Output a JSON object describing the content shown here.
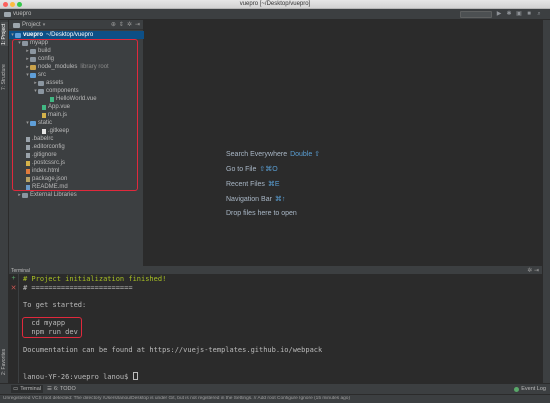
{
  "window": {
    "title": "vuepro [~/Desktop/vuepro]"
  },
  "toolbar": {
    "breadcrumb": "vuepro"
  },
  "left_strip": {
    "project_tab": "1: Project",
    "structure_tab": "7: Structure",
    "favorites_tab": "2: Favorites"
  },
  "project_panel": {
    "title": "Project",
    "root_label": "vuepro",
    "root_path": "~/Desktop/vuepro",
    "items": [
      {
        "label": "myapp",
        "kind": "folder",
        "arrow": "▾"
      },
      {
        "label": "build",
        "kind": "folder",
        "arrow": "▸"
      },
      {
        "label": "config",
        "kind": "folder",
        "arrow": "▸"
      },
      {
        "label": "node_modules",
        "kind": "folder",
        "arrow": "▸",
        "note": "library root"
      },
      {
        "label": "src",
        "kind": "folder",
        "arrow": "▾"
      },
      {
        "label": "assets",
        "kind": "folder",
        "arrow": "▸"
      },
      {
        "label": "components",
        "kind": "folder",
        "arrow": "▾"
      },
      {
        "label": "HelloWorld.vue",
        "kind": "vue"
      },
      {
        "label": "App.vue",
        "kind": "vue"
      },
      {
        "label": "main.js",
        "kind": "js"
      },
      {
        "label": "static",
        "kind": "folder",
        "arrow": "▾"
      },
      {
        "label": ".gitkeep",
        "kind": "file"
      },
      {
        "label": ".babelrc",
        "kind": "file"
      },
      {
        "label": ".editorconfig",
        "kind": "file"
      },
      {
        "label": ".gitignore",
        "kind": "file"
      },
      {
        "label": ".postcssrc.js",
        "kind": "js"
      },
      {
        "label": "index.html",
        "kind": "html"
      },
      {
        "label": "package.json",
        "kind": "json"
      },
      {
        "label": "README.md",
        "kind": "md"
      },
      {
        "label": "External Libraries",
        "kind": "lib"
      }
    ]
  },
  "editor_hints": [
    {
      "label": "Search Everywhere",
      "key": "Double ⇧"
    },
    {
      "label": "Go to File",
      "key": "⇧⌘O"
    },
    {
      "label": "Recent Files",
      "key": "⌘E"
    },
    {
      "label": "Navigation Bar",
      "key": "⌘↑"
    },
    {
      "label": "Drop files here to open",
      "key": ""
    }
  ],
  "terminal": {
    "title": "Terminal",
    "lines": [
      "# Project initialization finished!",
      "# ========================",
      "",
      "To get started:",
      "",
      "  cd myapp",
      "  npm run dev",
      "",
      "Documentation can be found at https://vuejs-templates.github.io/webpack",
      "",
      "",
      "lanou-YF-26:vuepro lanou$ "
    ]
  },
  "bottom_tabs": {
    "terminal": "Terminal",
    "todo": "6: TODO",
    "event_log": "Event Log"
  },
  "status": {
    "message": "Unregistered VCS root detected: The directory /Users/lanou/Desktop is under Git, but is not registered in the Settings. // Add root  Configure  Ignore (15 minutes ago)"
  },
  "colors": {
    "highlight_red": "#e0293c",
    "selection": "#0d4f86",
    "terminal_green": "#a8c023"
  }
}
